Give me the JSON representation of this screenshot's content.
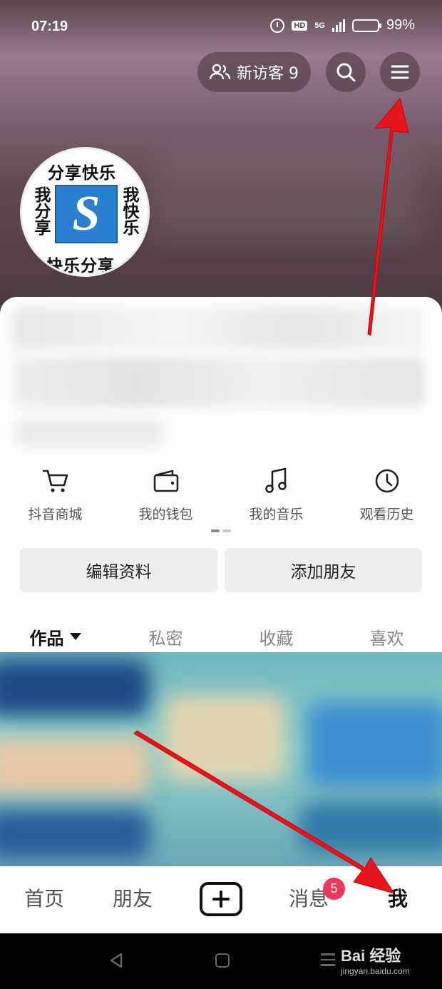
{
  "status_bar": {
    "time": "07:19",
    "network": "5G",
    "hd": "HD",
    "battery": "99%",
    "battery_level": 0.99
  },
  "header": {
    "visitor_label": "新访客 9",
    "search_icon": "search-icon",
    "menu_icon": "menu-icon"
  },
  "avatar": {
    "top_text": "分享快乐",
    "bottom_text": "快乐分享",
    "left_text": "我分享",
    "right_text": "我快乐",
    "logo_letter": "S"
  },
  "quick_entries": [
    {
      "label": "抖音商城",
      "icon": "cart-icon"
    },
    {
      "label": "我的钱包",
      "icon": "wallet-icon"
    },
    {
      "label": "我的音乐",
      "icon": "music-icon"
    },
    {
      "label": "观看历史",
      "icon": "clock-icon"
    }
  ],
  "actions": {
    "edit_profile": "编辑资料",
    "add_friends": "添加朋友"
  },
  "tabs": [
    {
      "label": "作品",
      "active": true
    },
    {
      "label": "私密",
      "active": false
    },
    {
      "label": "收藏",
      "active": false
    },
    {
      "label": "喜欢",
      "active": false
    }
  ],
  "bottom_nav": {
    "home": "首页",
    "friends": "朋友",
    "messages": "消息",
    "messages_badge": "5",
    "me": "我"
  },
  "watermark": {
    "main": "Bai 经验",
    "sub": "jingyan.baidu.com"
  },
  "colors": {
    "accent_red": "#f5365c",
    "arrow_red": "#e8141e"
  }
}
